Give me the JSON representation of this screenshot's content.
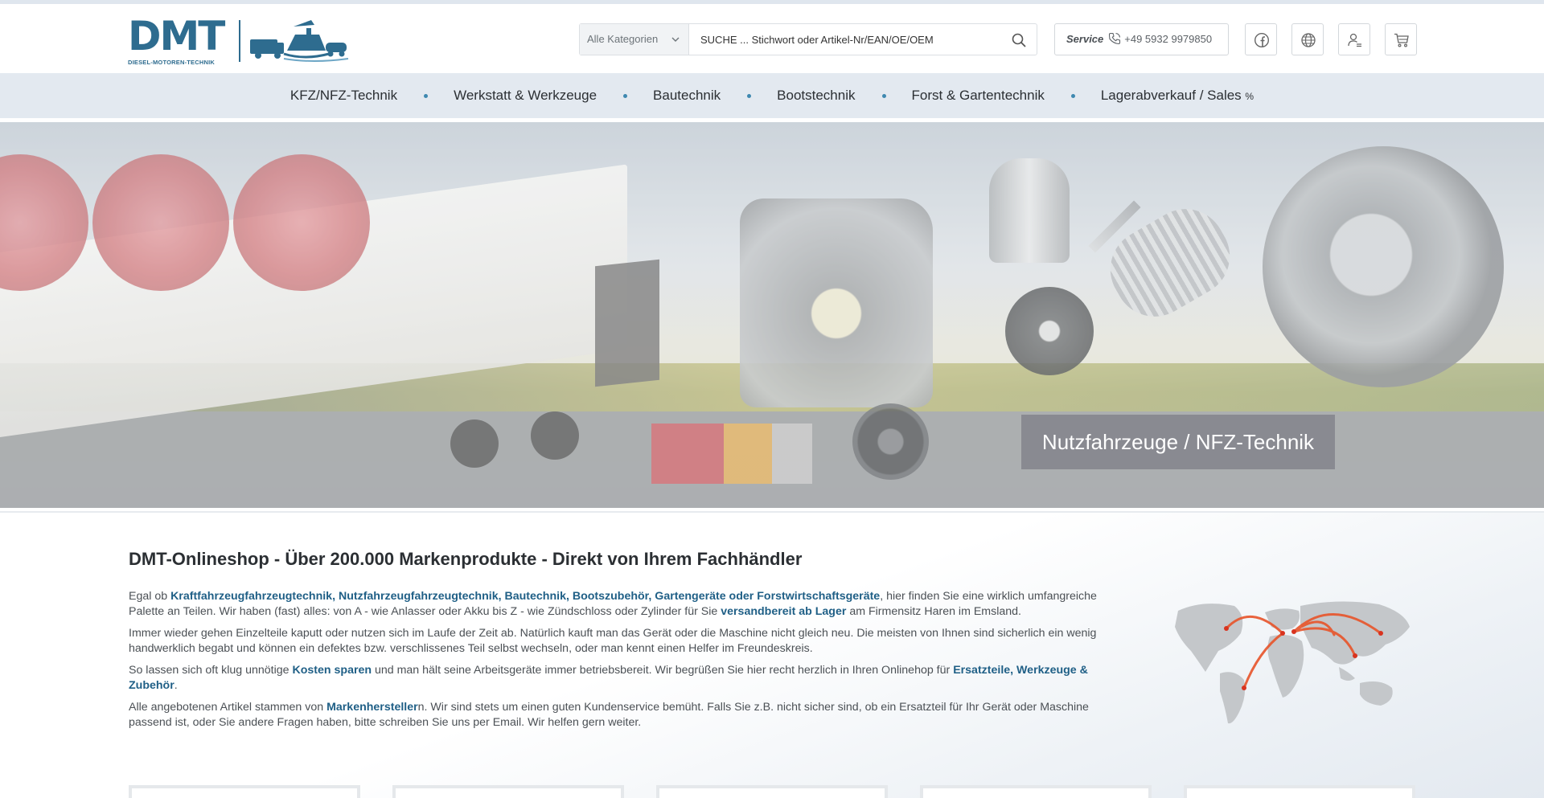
{
  "header": {
    "logo_main": "DMT",
    "logo_sub": "DIESEL-MOTOREN-TECHNIK",
    "search": {
      "category_value": "Alle Kategorien",
      "placeholder": "SUCHE ... Stichwort oder Artikel-Nr/EAN/OE/OEM"
    },
    "service": {
      "label": "Service",
      "phone": "+49 5932 9979850"
    },
    "icons": [
      "facebook-icon",
      "globe-icon",
      "account-icon",
      "cart-icon"
    ]
  },
  "nav": {
    "items": [
      {
        "label": "KFZ/NFZ-Technik"
      },
      {
        "label": "Werkstatt & Werkzeuge"
      },
      {
        "label": "Bautechnik"
      },
      {
        "label": "Bootstechnik"
      },
      {
        "label": "Forst & Gartentechnik"
      },
      {
        "label": "Lagerabverkauf / Sales",
        "suffix": "%"
      }
    ]
  },
  "hero": {
    "caption": "Nutzfahrzeuge / NFZ-Technik"
  },
  "main": {
    "title": "DMT-Onlineshop - Über 200.000 Markenprodukte - Direkt von Ihrem Fachhändler",
    "p1": {
      "t1": "Egal ob ",
      "l1": "Kraftfahrzeugfahrzeugtechnik, Nutzfahrzeugfahrzeugtechnik, Bautechnik, Bootszubehör, Gartengeräte oder Forstwirtschaftsgeräte",
      "t2": ", hier finden Sie eine wirklich umfangreiche Palette an Teilen. Wir haben (fast) alles: von A - wie Anlasser oder Akku bis Z - wie Zündschloss oder Zylinder für Sie ",
      "l2": "versandbereit ab Lager",
      "t3": " am Firmensitz Haren im Emsland."
    },
    "p2": "Immer wieder gehen Einzelteile kaputt oder nutzen sich im Laufe der Zeit ab. Natürlich kauft man das Gerät oder die Maschine nicht gleich neu. Die meisten von Ihnen sind sicherlich ein wenig handwerklich begabt und können ein defektes bzw. verschlissenes Teil selbst wechseln, oder man kennt einen Helfer im Freundeskreis.",
    "p3": {
      "t1": "So lassen sich oft klug unnötige ",
      "l1": "Kosten sparen",
      "t2": " und man hält seine Arbeitsgeräte immer betriebsbereit. Wir begrüßen Sie hier recht herzlich in Ihren Onlinehop für ",
      "l2": "Ersatzteile, Werkzeuge & Zubehör",
      "t3": "."
    },
    "p4": {
      "t1": "Alle angebotenen Artikel stammen von ",
      "l1": "Markenhersteller",
      "t2": "n. Wir sind stets um einen guten Kundenservice bemüht. Falls Sie z.B. nicht sicher sind, ob ein Ersatzteil für Ihr Gerät oder Maschine passend ist, oder Sie andere Fragen haben, bitte schreiben Sie uns per Email. Wir helfen gern weiter."
    }
  },
  "colors": {
    "brand": "#2e6c8f",
    "link": "#1f5f86",
    "nav_bg": "#e3e9f0"
  }
}
